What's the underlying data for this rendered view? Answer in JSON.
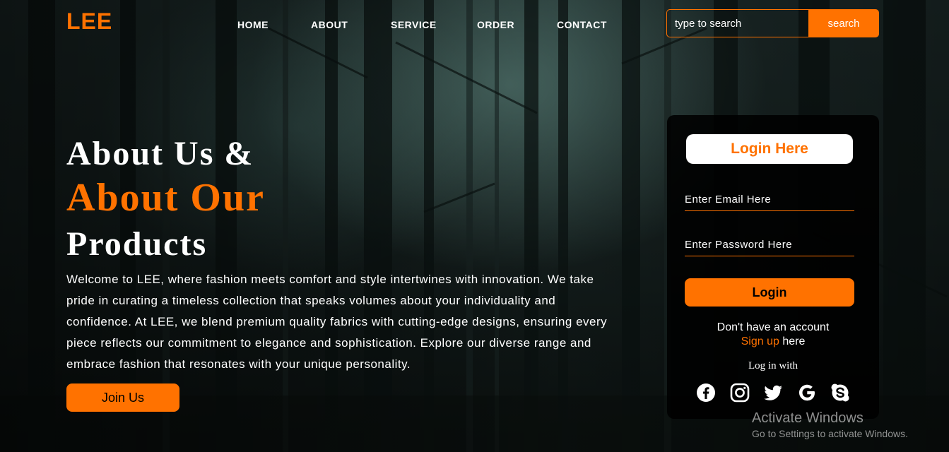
{
  "brand": {
    "logo": "LEE"
  },
  "nav": {
    "items": [
      "HOME",
      "ABOUT",
      "SERVICE",
      "ORDER",
      "CONTACT"
    ]
  },
  "search": {
    "placeholder": "type to search",
    "button": "search"
  },
  "hero": {
    "line1": "About Us &",
    "line2": "About Our",
    "line3": "Products",
    "paragraph": "Welcome to LEE, where fashion meets comfort and style intertwines with innovation. We take pride in curating a timeless collection that speaks volumes about your individuality and confidence. At LEE, we blend premium quality fabrics with cutting-edge designs, ensuring every piece reflects our commitment to elegance and sophistication. Explore our diverse range and embrace fashion that resonates with your unique personality.",
    "cta": "Join Us"
  },
  "login": {
    "title": "Login Here",
    "email_placeholder": "Enter Email Here",
    "password_placeholder": "Enter Password Here",
    "button": "Login",
    "no_account": "Don't have an account",
    "signup_link": "Sign up",
    "signup_suffix": " here",
    "log_with": "Log in with",
    "social_icons": [
      "facebook-icon",
      "instagram-icon",
      "twitter-icon",
      "google-icon",
      "skype-icon"
    ]
  },
  "watermark": {
    "title": "Activate Windows",
    "subtitle": "Go to Settings to activate Windows."
  },
  "colors": {
    "accent": "#ff7200",
    "card": "#000000",
    "text": "#ffffff"
  }
}
